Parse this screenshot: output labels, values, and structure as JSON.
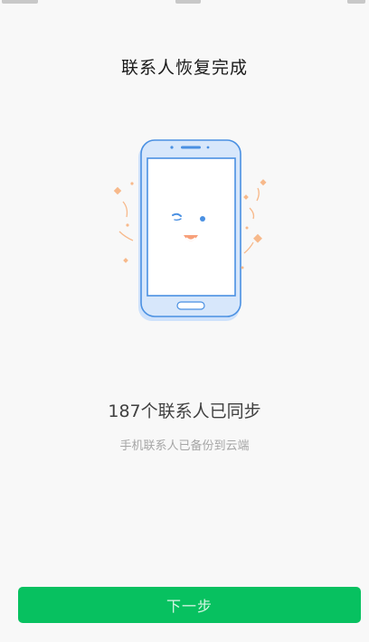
{
  "header": {
    "title": "联系人恢复完成"
  },
  "illustration": {
    "icon": "smiling-phone-icon",
    "accent": "#4a90e2",
    "confetti_color": "#f7b98b"
  },
  "result": {
    "count_text": "187个联系人已同步",
    "sub_text": "手机联系人已备份到云端"
  },
  "footer": {
    "next_label": "下一步",
    "button_color": "#07c160"
  }
}
